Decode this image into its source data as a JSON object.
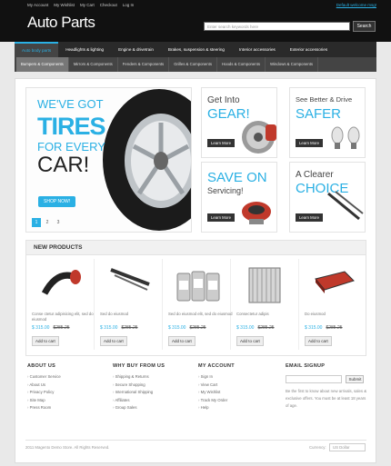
{
  "header": {
    "top_links": [
      "My Account",
      "My Wishlist",
      "My Cart",
      "Checkout",
      "Log In"
    ],
    "welcome": "Default welcome msg!",
    "logo": "Auto Parts",
    "search_placeholder": "Enter search keywords here",
    "search_button": "Search"
  },
  "nav": {
    "main": [
      "Auto body parts",
      "Headlights & lighting",
      "Engine & drivetrain",
      "Brakes, suspension & steering",
      "Interior accessories",
      "Exterior accessories"
    ],
    "sub": [
      "Bumpers & Components",
      "Mirrors & Components",
      "Fenders & Components",
      "Grilles & Components",
      "Hoods & Components",
      "Windows & Components"
    ]
  },
  "hero": {
    "line1": "WE'VE GOT",
    "line2": "TIRES",
    "line3": "FOR EVERY",
    "line4": "CAR!",
    "shop_now": "SHOP NOW!",
    "pages": [
      "1",
      "2",
      "3"
    ]
  },
  "promos": [
    {
      "line1": "Get Into",
      "line2": "GEAR!",
      "button": "Learn More"
    },
    {
      "line1": "See Better & Drive",
      "line2": "SAFER",
      "button": "Learn More"
    },
    {
      "line1": "SAVE ON",
      "line2": "Servicing!",
      "button": "Learn More"
    },
    {
      "line1": "A Clearer",
      "line2": "CHOICE",
      "button": "Learn More"
    }
  ],
  "new_products": {
    "title": "NEW PRODUCTS",
    "items": [
      {
        "name": "Conse ctetur adipisicing elit, sed do eiusmod",
        "price": "$ 315.00",
        "old_price": "$285.25",
        "add": "Add to cart"
      },
      {
        "name": "Sed do eiusmod",
        "price": "$ 315.00",
        "old_price": "$285.25",
        "add": "Add to cart"
      },
      {
        "name": "Sed do eiusmod elit, sed do eiusmod",
        "price": "$ 315.00",
        "old_price": "$285.25",
        "add": "Add to cart"
      },
      {
        "name": "Consectetur adipis",
        "price": "$ 315.00",
        "old_price": "$285.25",
        "add": "Add to cart"
      },
      {
        "name": "Do eiusmod",
        "price": "$ 315.00",
        "old_price": "$285.25",
        "add": "Add to cart"
      }
    ]
  },
  "footer": {
    "about": {
      "title": "ABOUT US",
      "links": [
        "Customer Service",
        "About Us",
        "Privacy Policy",
        "Site Map",
        "Press Room"
      ]
    },
    "why": {
      "title": "WHY BUY FROM US",
      "links": [
        "Shipping & Returns",
        "Secure Shopping",
        "International Shipping",
        "Affiliates",
        "Group Sales"
      ]
    },
    "account": {
      "title": "MY ACCOUNT",
      "links": [
        "Sign In",
        "View Cart",
        "My Wishlist",
        "Track My Order",
        "Help"
      ]
    },
    "email": {
      "title": "EMAIL SIGNUP",
      "button": "Submit",
      "text": "Be the first to know about new arrivals, sales & exclusive offers. You must be at least 18 years of age."
    },
    "copyright": "2011 Magento Demo Store. All Rights Reserved.",
    "currency_label": "Currency:",
    "currency_value": "US Dollar"
  },
  "colors": {
    "accent": "#2ab0e4",
    "dark": "#111111"
  }
}
